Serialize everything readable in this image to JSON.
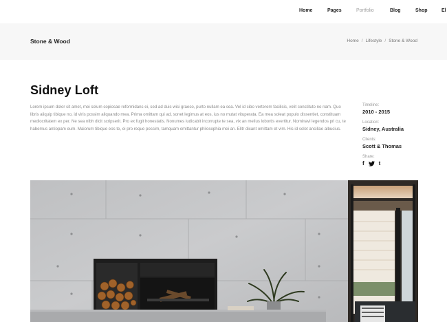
{
  "nav": {
    "items": [
      {
        "label": "Home",
        "active": false
      },
      {
        "label": "Pages",
        "active": false
      },
      {
        "label": "Portfolio",
        "active": true
      },
      {
        "label": "Blog",
        "active": false
      },
      {
        "label": "Shop",
        "active": false
      },
      {
        "label": "El",
        "active": false
      }
    ]
  },
  "titlebar": {
    "heading": "Stone & Wood",
    "breadcrumb": [
      "Home",
      "Lifestyle",
      "Stone & Wood"
    ],
    "separator": "/"
  },
  "project": {
    "title": "Sidney Loft",
    "description": "Lorem ipsum dolor sit amet, mei solum copiosae reformidans ei, sed ad duis wisi graeco, purto nullam ea sea. Vel id cibo verterem facilisis, velit constituto no nam. Quo libris aliquip tibique no, id viris possim aliquando mea. Prima omittam qui ad, sonet legimus at eos, ius no mutat vituperata. Ea mea soleat populo dissentiet, constituam mediocritatem ex per. Ne sea nibh dicit scripserit. Pro ex fugit honestatis. Nonumes iudicabit incorrupte te sea, vix an melius lobortis evertitur. Nominavi legendos pri cu, te habemus antiopam eum. Maiorum tibique eos te, ei pro reque possim, tamquam omittantur philosophia mei an. Elitr dicant omittam et vim. His id solet ancillae albucius.",
    "meta": {
      "timeline_label": "Timeline:",
      "timeline_value": "2010 - 2015",
      "location_label": "Location:",
      "location_value": "Sidney, Australia",
      "clients_label": "Clients:",
      "clients_value": "Scott & Thomas",
      "share_label": "Share:",
      "share_icons": [
        "f",
        "t",
        "t"
      ]
    }
  }
}
